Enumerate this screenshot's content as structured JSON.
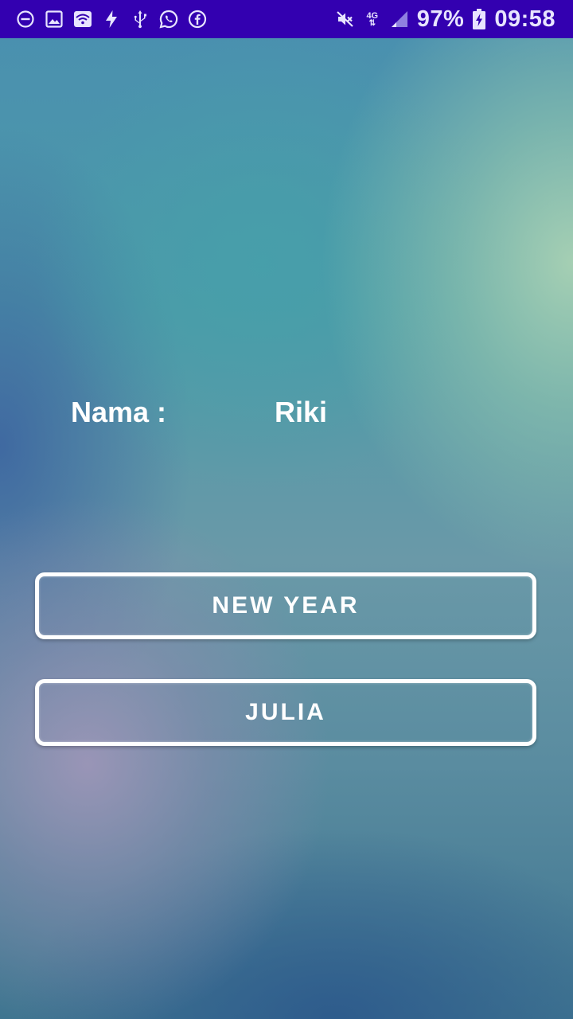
{
  "status_bar": {
    "background": "#3300b0",
    "left_icons": [
      "do-not-disturb-icon",
      "gallery-icon",
      "wifi-icon",
      "flash-icon",
      "usb-icon",
      "whatsapp-icon",
      "facebook-icon"
    ],
    "right_icons": [
      "mute-icon",
      "network-4g-icon",
      "signal-icon",
      "battery-charging-icon"
    ],
    "network_label": "4G",
    "battery_percent": "97%",
    "time": "09:58"
  },
  "profile": {
    "name_label": "Nama :",
    "name_value": "Riki"
  },
  "buttons": {
    "new_year_label": "NEW YEAR",
    "julia_label": "JULIA"
  }
}
